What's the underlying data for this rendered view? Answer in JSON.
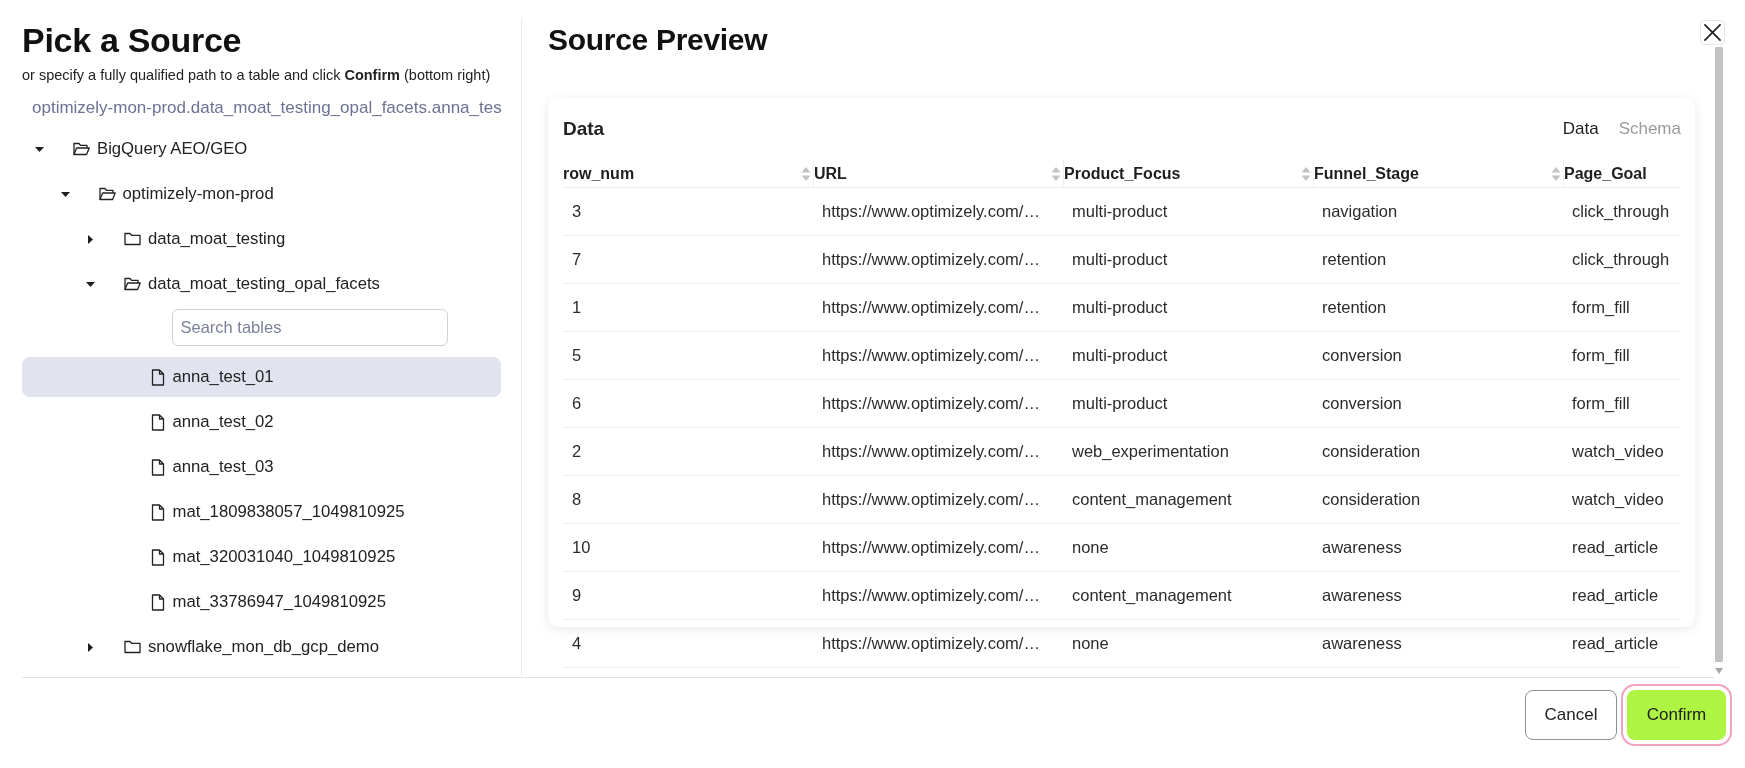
{
  "dialog": {
    "title": "Pick a Source",
    "subtitle": "or specify a fully qualified path to a table and click **Confirm** (bottom right)",
    "path_field": {
      "value": "optimizely-mon-prod.data_moat_testing_opal_facets.anna_tes"
    },
    "tree": [
      {
        "label": "BigQuery AEO/GEO",
        "kind": "folder",
        "expanded": true,
        "selected": false,
        "children": [
          {
            "label": "optimizely-mon-prod",
            "kind": "folder",
            "expanded": true,
            "selected": false,
            "children": [
              {
                "label": "data_moat_testing",
                "kind": "folder",
                "expanded": false,
                "selected": false
              },
              {
                "label": "data_moat_testing_opal_facets",
                "kind": "folder",
                "expanded": true,
                "selected": false,
                "search": {
                  "placeholder": "Search tables"
                },
                "children": [
                  {
                    "label": "anna_test_01",
                    "kind": "table",
                    "selected": true
                  },
                  {
                    "label": "anna_test_02",
                    "kind": "table",
                    "selected": false
                  },
                  {
                    "label": "anna_test_03",
                    "kind": "table",
                    "selected": false
                  },
                  {
                    "label": "mat_1809838057_1049810925",
                    "kind": "table",
                    "selected": false
                  },
                  {
                    "label": "mat_320031040_1049810925",
                    "kind": "table",
                    "selected": false
                  },
                  {
                    "label": "mat_33786947_1049810925",
                    "kind": "table",
                    "selected": false
                  }
                ]
              },
              {
                "label": "snowflake_mon_db_gcp_demo",
                "kind": "folder",
                "expanded": false,
                "selected": false
              }
            ]
          }
        ]
      }
    ]
  },
  "preview": {
    "title": "Source Preview",
    "card": {
      "title": "Data",
      "tabs": [
        {
          "label": "Data",
          "selected": true
        },
        {
          "label": "Schema",
          "selected": false
        }
      ],
      "table": {
        "columns": [
          "row_num",
          "URL",
          "Product_Focus",
          "Funnel_Stage",
          "Page_Goal"
        ],
        "rows": [
          [
            "3",
            "https://www.optimizely.com/…",
            "multi-product",
            "navigation",
            "click_through"
          ],
          [
            "7",
            "https://www.optimizely.com/…",
            "multi-product",
            "retention",
            "click_through"
          ],
          [
            "1",
            "https://www.optimizely.com/…",
            "multi-product",
            "retention",
            "form_fill"
          ],
          [
            "5",
            "https://www.optimizely.com/…",
            "multi-product",
            "conversion",
            "form_fill"
          ],
          [
            "6",
            "https://www.optimizely.com/…",
            "multi-product",
            "conversion",
            "form_fill"
          ],
          [
            "2",
            "https://www.optimizely.com/…",
            "web_experimentation",
            "consideration",
            "watch_video"
          ],
          [
            "8",
            "https://www.optimizely.com/…",
            "content_management",
            "consideration",
            "watch_video"
          ],
          [
            "10",
            "https://www.optimizely.com/…",
            "none",
            "awareness",
            "read_article"
          ],
          [
            "9",
            "https://www.optimizely.com/…",
            "content_management",
            "awareness",
            "read_article"
          ],
          [
            "4",
            "https://www.optimizely.com/…",
            "none",
            "awareness",
            "read_article"
          ]
        ]
      }
    }
  },
  "footer": {
    "buttons": [
      {
        "label": "Cancel",
        "kind": "secondary",
        "focused": false
      },
      {
        "label": "Confirm",
        "kind": "primary",
        "focused": true
      }
    ]
  }
}
